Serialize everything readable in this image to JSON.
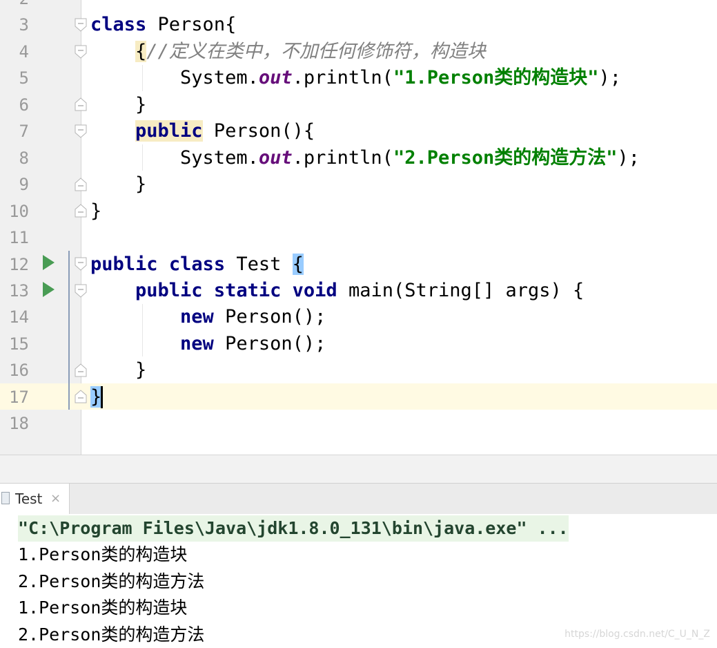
{
  "editor": {
    "lines": [
      {
        "number": "2",
        "segments": []
      },
      {
        "number": "3",
        "segments": [
          {
            "t": "class",
            "c": "kw"
          },
          {
            "t": " Person{"
          }
        ]
      },
      {
        "number": "4",
        "segments": [
          {
            "t": "    "
          },
          {
            "t": "{",
            "c": "hl-y"
          },
          {
            "t": "//定义在类中，不加任何修饰符，构造块",
            "c": "cmt"
          }
        ]
      },
      {
        "number": "5",
        "segments": [
          {
            "t": "        System."
          },
          {
            "t": "out",
            "c": "fld"
          },
          {
            "t": ".println("
          },
          {
            "t": "\"1.Person类的构造块\"",
            "c": "str"
          },
          {
            "t": ");"
          }
        ]
      },
      {
        "number": "6",
        "segments": [
          {
            "t": "    }"
          }
        ]
      },
      {
        "number": "7",
        "segments": [
          {
            "t": "    "
          },
          {
            "t": "public",
            "c": "kw hl-y"
          },
          {
            "t": " Person(){"
          }
        ]
      },
      {
        "number": "8",
        "segments": [
          {
            "t": "        System."
          },
          {
            "t": "out",
            "c": "fld"
          },
          {
            "t": ".println("
          },
          {
            "t": "\"2.Person类的构造方法\"",
            "c": "str"
          },
          {
            "t": ");"
          }
        ]
      },
      {
        "number": "9",
        "segments": [
          {
            "t": "    }"
          }
        ]
      },
      {
        "number": "10",
        "segments": [
          {
            "t": "}"
          }
        ]
      },
      {
        "number": "11",
        "segments": []
      },
      {
        "number": "12",
        "segments": [
          {
            "t": "public",
            "c": "kw"
          },
          {
            "t": " "
          },
          {
            "t": "class",
            "c": "kw"
          },
          {
            "t": " Test "
          },
          {
            "t": "{",
            "c": "hl-b"
          }
        ]
      },
      {
        "number": "13",
        "segments": [
          {
            "t": "    "
          },
          {
            "t": "public",
            "c": "kw"
          },
          {
            "t": " "
          },
          {
            "t": "static",
            "c": "kw"
          },
          {
            "t": " "
          },
          {
            "t": "void",
            "c": "kw"
          },
          {
            "t": " main(String[] args) {"
          }
        ]
      },
      {
        "number": "14",
        "segments": [
          {
            "t": "        "
          },
          {
            "t": "new",
            "c": "kw"
          },
          {
            "t": " Person();"
          }
        ]
      },
      {
        "number": "15",
        "segments": [
          {
            "t": "        "
          },
          {
            "t": "new",
            "c": "kw"
          },
          {
            "t": " Person();"
          }
        ]
      },
      {
        "number": "16",
        "segments": [
          {
            "t": "    }"
          }
        ]
      },
      {
        "number": "17",
        "segments": [
          {
            "t": "}",
            "c": "hl-b"
          }
        ]
      },
      {
        "number": "18",
        "segments": []
      }
    ]
  },
  "run_tab": {
    "label": "Test",
    "close": "×"
  },
  "console": {
    "command": "\"C:\\Program Files\\Java\\jdk1.8.0_131\\bin\\java.exe\" ...",
    "output": [
      "1.Person类的构造块",
      "2.Person类的构造方法",
      "1.Person类的构造块",
      "2.Person类的构造方法"
    ]
  },
  "watermark": "https://blog.csdn.net/C_U_N_Z"
}
